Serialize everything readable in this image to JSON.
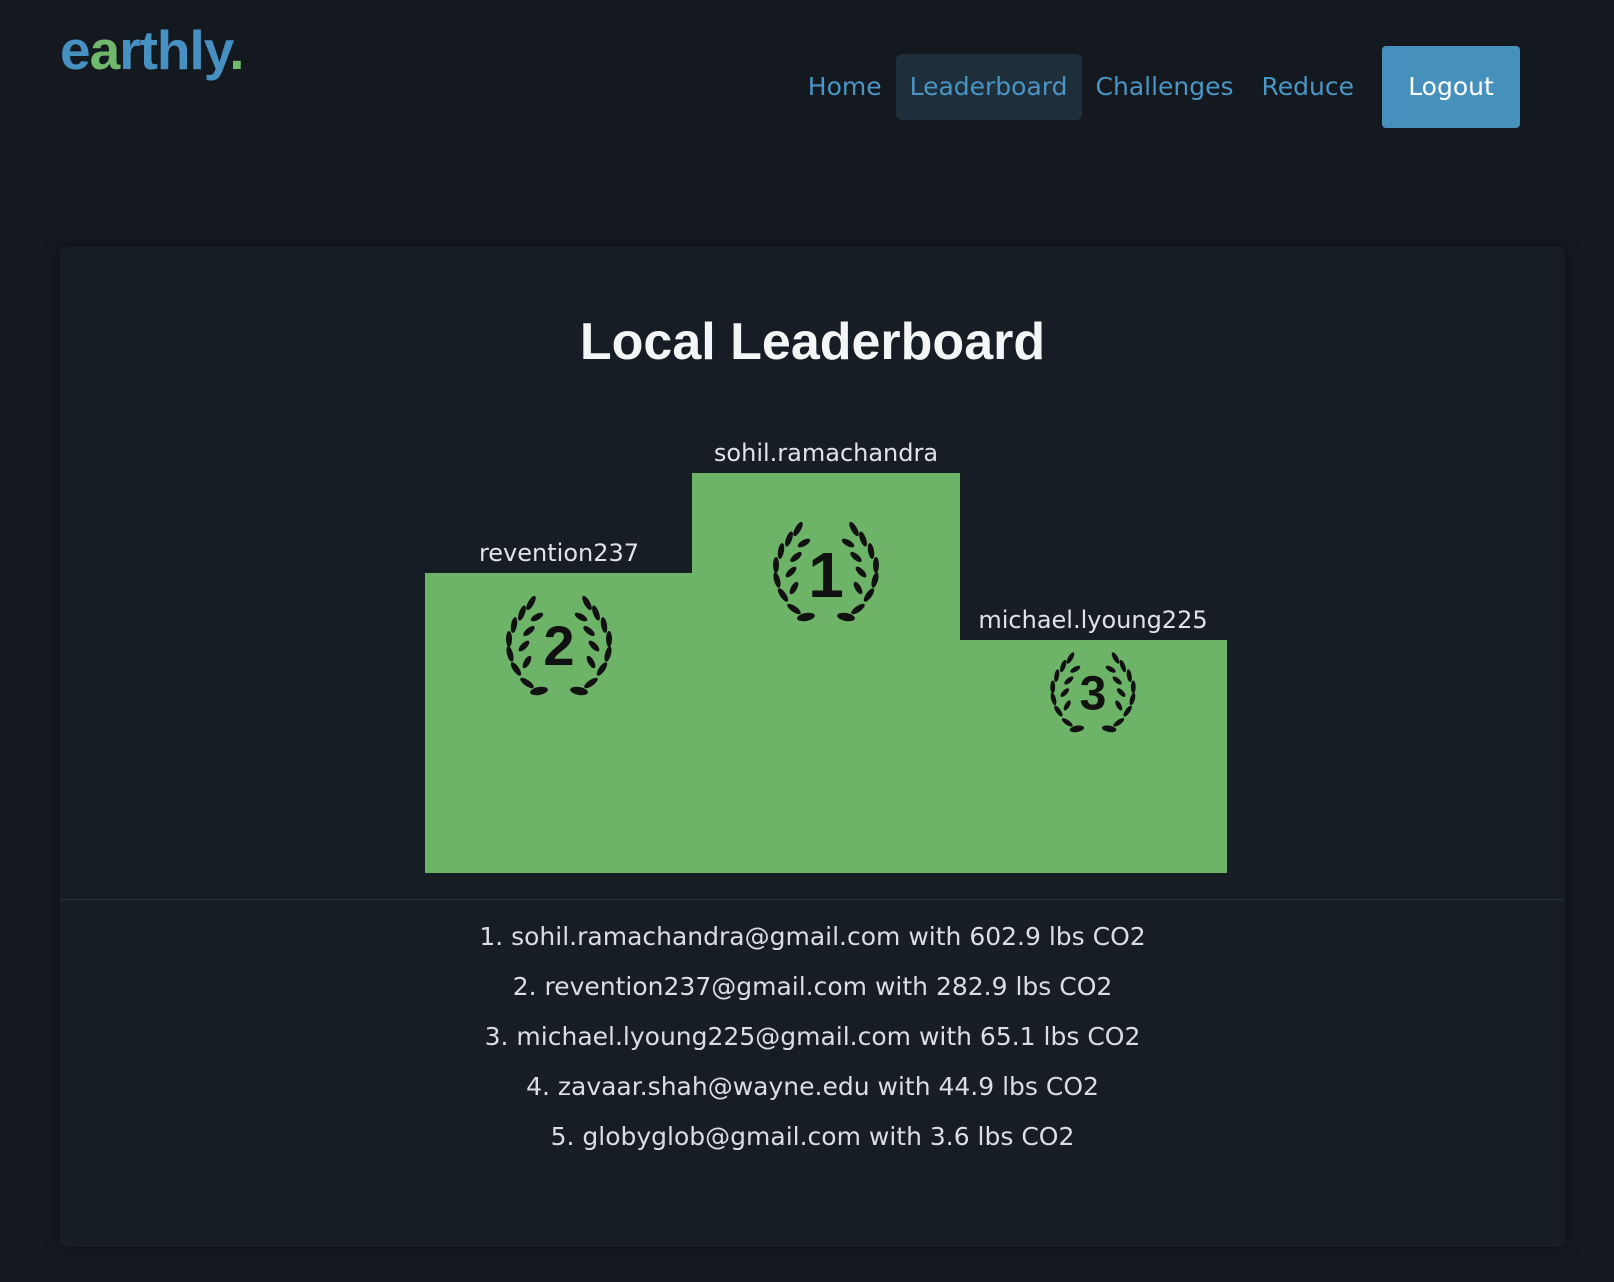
{
  "brand": {
    "parts": [
      "e",
      "a",
      "rthly",
      "."
    ],
    "colors": [
      "#4691c2",
      "#70b86b",
      "#4691c2",
      "#70b86b"
    ]
  },
  "nav": {
    "items": [
      {
        "label": "Home",
        "active": false
      },
      {
        "label": "Leaderboard",
        "active": true
      },
      {
        "label": "Challenges",
        "active": false
      },
      {
        "label": "Reduce",
        "active": false
      }
    ],
    "logout_label": "Logout"
  },
  "leaderboard": {
    "title": "Local Leaderboard",
    "podium": {
      "first": {
        "name": "sohil.ramachandra",
        "rank": "1"
      },
      "second": {
        "name": "revention237",
        "rank": "2"
      },
      "third": {
        "name": "michael.lyoung225",
        "rank": "3"
      }
    },
    "entries": [
      "1. sohil.ramachandra@gmail.com with 602.9 lbs CO2",
      "2. revention237@gmail.com with 282.9 lbs CO2",
      "3. michael.lyoung225@gmail.com with 65.1 lbs CO2",
      "4. zavaar.shah@wayne.edu with 44.9 lbs CO2",
      "5. globyglob@gmail.com with 3.6 lbs CO2"
    ]
  },
  "colors": {
    "background": "#141920",
    "card": "#171d24",
    "podium_green": "#6db468",
    "nav_link": "#4b95c4",
    "logout_button": "#4690bc"
  },
  "icons": {
    "podium_badge": "laurel-wreath-icon"
  }
}
